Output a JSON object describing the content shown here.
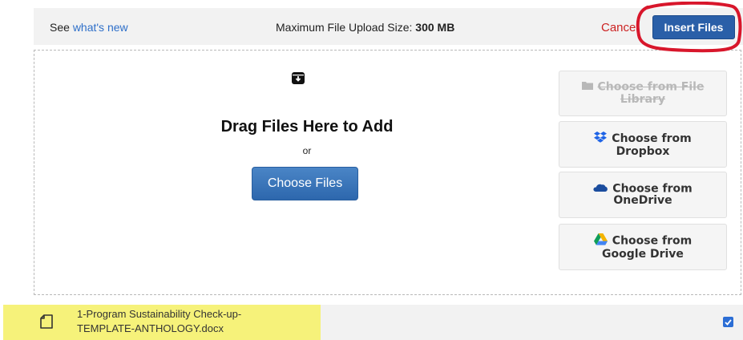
{
  "header": {
    "see_prefix": "See ",
    "whats_new_link": "what's new",
    "max_size_label": "Maximum File Upload Size: ",
    "max_size_value": "300 MB",
    "cancel_label": "Cance",
    "insert_button_label": "Insert Files"
  },
  "dropzone": {
    "icon": "inbox-download-icon",
    "title": "Drag Files Here to Add",
    "or_text": "or",
    "choose_button_label": "Choose Files"
  },
  "sources": [
    {
      "icon": "folder-icon",
      "line1": "Choose from File",
      "line2": "Library",
      "disabled": true
    },
    {
      "icon": "dropbox-icon",
      "line1": "Choose from",
      "line2": "Dropbox",
      "disabled": false
    },
    {
      "icon": "onedrive-cloud-icon",
      "line1": "Choose from",
      "line2": "OneDrive",
      "disabled": false
    },
    {
      "icon": "google-drive-icon",
      "line1": "Choose from",
      "line2": "Google Drive",
      "disabled": false
    }
  ],
  "file": {
    "icon": "document-icon",
    "name_line1": "1-Program Sustainability Check-up-",
    "name_line2": "TEMPLATE-ANTHOLOGY.docx",
    "checked": true
  },
  "colors": {
    "primary": "#2a5fa8",
    "cancel": "#cc2222",
    "link": "#2e6fc9",
    "highlight": "#f6f27a",
    "annotation": "#d8162b"
  }
}
